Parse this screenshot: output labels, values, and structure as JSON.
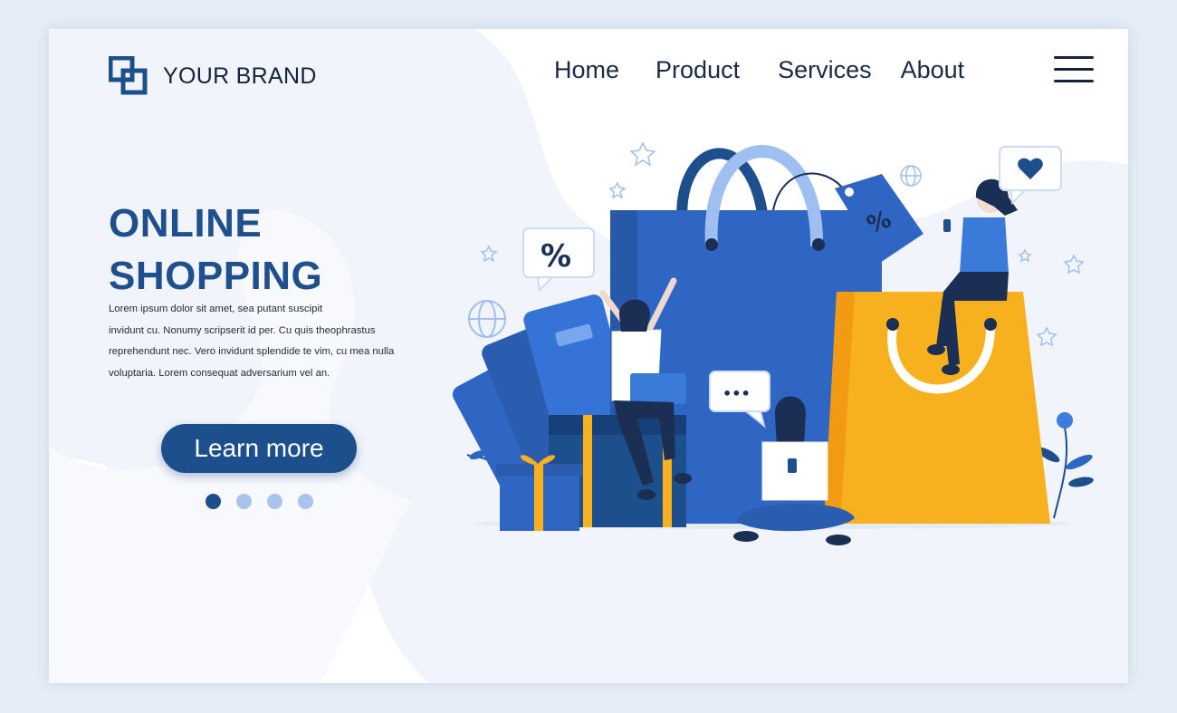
{
  "brand": {
    "name": "YOUR BRAND",
    "logo_icon": "squares-logo-icon"
  },
  "nav": {
    "items": [
      "Home",
      "Product",
      "Services",
      "About"
    ],
    "menu_icon": "hamburger-icon"
  },
  "hero": {
    "title_line1": "ONLINE",
    "title_line2": "SHOPPING",
    "body_lines": [
      "Lorem ipsum dolor sit amet, sea putant suscipit",
      "invidunt cu. Nonumy scripserit id per. Cu quis theophrastus",
      "reprehendunt nec. Vero invidunt splendide te vim, cu mea nulla",
      "voluptaria. Lorem consequat adversarium vel an."
    ],
    "cta_label": "Learn more"
  },
  "carousel": {
    "total": 4,
    "active": 1
  },
  "illustration": {
    "discount_symbol": "%",
    "chat_symbol": "•••",
    "icons": [
      "shopping-bag-icon",
      "price-tag-icon",
      "gift-box-icon",
      "credit-card-icon",
      "globe-icon",
      "heart-icon",
      "star-icon",
      "plant-icon"
    ]
  },
  "colors": {
    "primary": "#1e4f8d",
    "bag_blue": "#2f66c4",
    "bag_yellow": "#f7b11e",
    "dot_inactive": "#a8c4ec"
  }
}
